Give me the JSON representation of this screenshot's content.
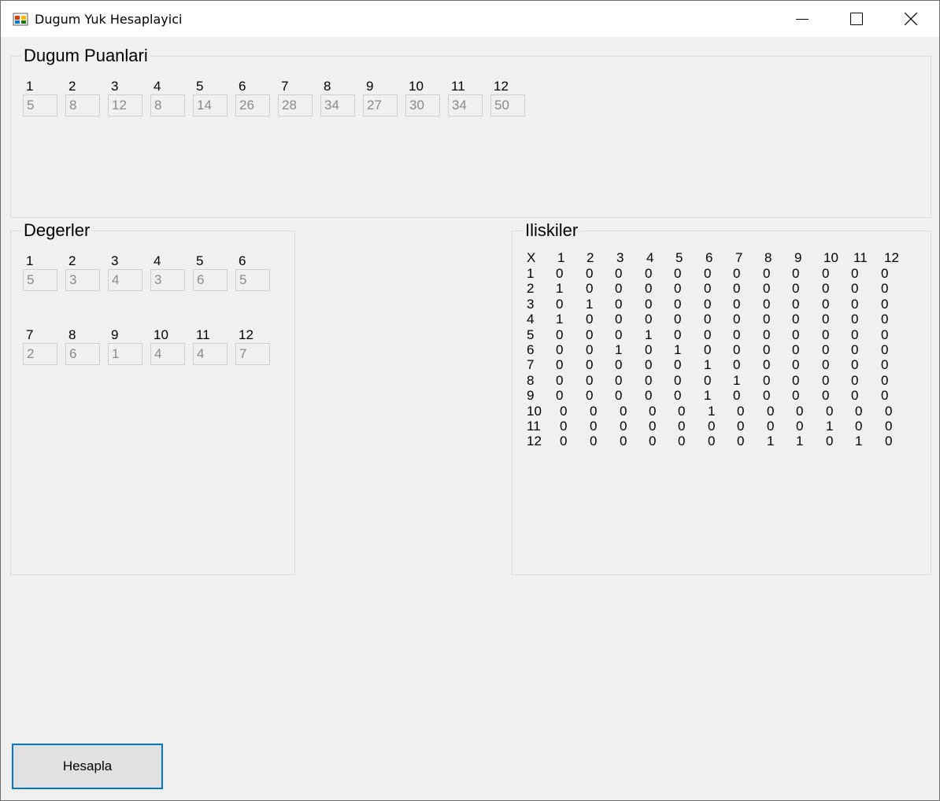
{
  "window": {
    "title": "Dugum Yuk Hesaplayici"
  },
  "puanlar": {
    "title": "Dugum Puanlari",
    "items": [
      {
        "label": "1",
        "value": "5"
      },
      {
        "label": "2",
        "value": "8"
      },
      {
        "label": "3",
        "value": "12"
      },
      {
        "label": "4",
        "value": "8"
      },
      {
        "label": "5",
        "value": "14"
      },
      {
        "label": "6",
        "value": "26"
      },
      {
        "label": "7",
        "value": "28"
      },
      {
        "label": "8",
        "value": "34"
      },
      {
        "label": "9",
        "value": "27"
      },
      {
        "label": "10",
        "value": "30"
      },
      {
        "label": "11",
        "value": "34"
      },
      {
        "label": "12",
        "value": "50"
      }
    ]
  },
  "degerler": {
    "title": "Degerler",
    "items": [
      {
        "label": "1",
        "value": "5"
      },
      {
        "label": "2",
        "value": "3"
      },
      {
        "label": "3",
        "value": "4"
      },
      {
        "label": "4",
        "value": "3"
      },
      {
        "label": "5",
        "value": "6"
      },
      {
        "label": "6",
        "value": "5"
      },
      {
        "label": "7",
        "value": "2"
      },
      {
        "label": "8",
        "value": "6"
      },
      {
        "label": "9",
        "value": "1"
      },
      {
        "label": "10",
        "value": "4"
      },
      {
        "label": "11",
        "value": "4"
      },
      {
        "label": "12",
        "value": "7"
      }
    ]
  },
  "iliskiler": {
    "title": "Iliskiler",
    "header": [
      "X",
      "1",
      "2",
      "3",
      "4",
      "5",
      "6",
      "7",
      "8",
      "9",
      "10",
      "11",
      "12"
    ],
    "rows": [
      [
        "1",
        "0",
        "0",
        "0",
        "0",
        "0",
        "0",
        "0",
        "0",
        "0",
        "0",
        "0",
        "0"
      ],
      [
        "2",
        "1",
        "0",
        "0",
        "0",
        "0",
        "0",
        "0",
        "0",
        "0",
        "0",
        "0",
        "0"
      ],
      [
        "3",
        "0",
        "1",
        "0",
        "0",
        "0",
        "0",
        "0",
        "0",
        "0",
        "0",
        "0",
        "0"
      ],
      [
        "4",
        "1",
        "0",
        "0",
        "0",
        "0",
        "0",
        "0",
        "0",
        "0",
        "0",
        "0",
        "0"
      ],
      [
        "5",
        "0",
        "0",
        "0",
        "1",
        "0",
        "0",
        "0",
        "0",
        "0",
        "0",
        "0",
        "0"
      ],
      [
        "6",
        "0",
        "0",
        "1",
        "0",
        "1",
        "0",
        "0",
        "0",
        "0",
        "0",
        "0",
        "0"
      ],
      [
        "7",
        "0",
        "0",
        "0",
        "0",
        "0",
        "1",
        "0",
        "0",
        "0",
        "0",
        "0",
        "0"
      ],
      [
        "8",
        "0",
        "0",
        "0",
        "0",
        "0",
        "0",
        "1",
        "0",
        "0",
        "0",
        "0",
        "0"
      ],
      [
        "9",
        "0",
        "0",
        "0",
        "0",
        "0",
        "1",
        "0",
        "0",
        "0",
        "0",
        "0",
        "0"
      ],
      [
        "10",
        "0",
        "0",
        "0",
        "0",
        "0",
        "1",
        "0",
        "0",
        "0",
        "0",
        "0",
        "0"
      ],
      [
        "11",
        "0",
        "0",
        "0",
        "0",
        "0",
        "0",
        "0",
        "0",
        "0",
        "1",
        "0",
        "0"
      ],
      [
        "12",
        "0",
        "0",
        "0",
        "0",
        "0",
        "0",
        "0",
        "1",
        "1",
        "0",
        "1",
        "0"
      ]
    ]
  },
  "actions": {
    "calculate_label": "Hesapla"
  }
}
